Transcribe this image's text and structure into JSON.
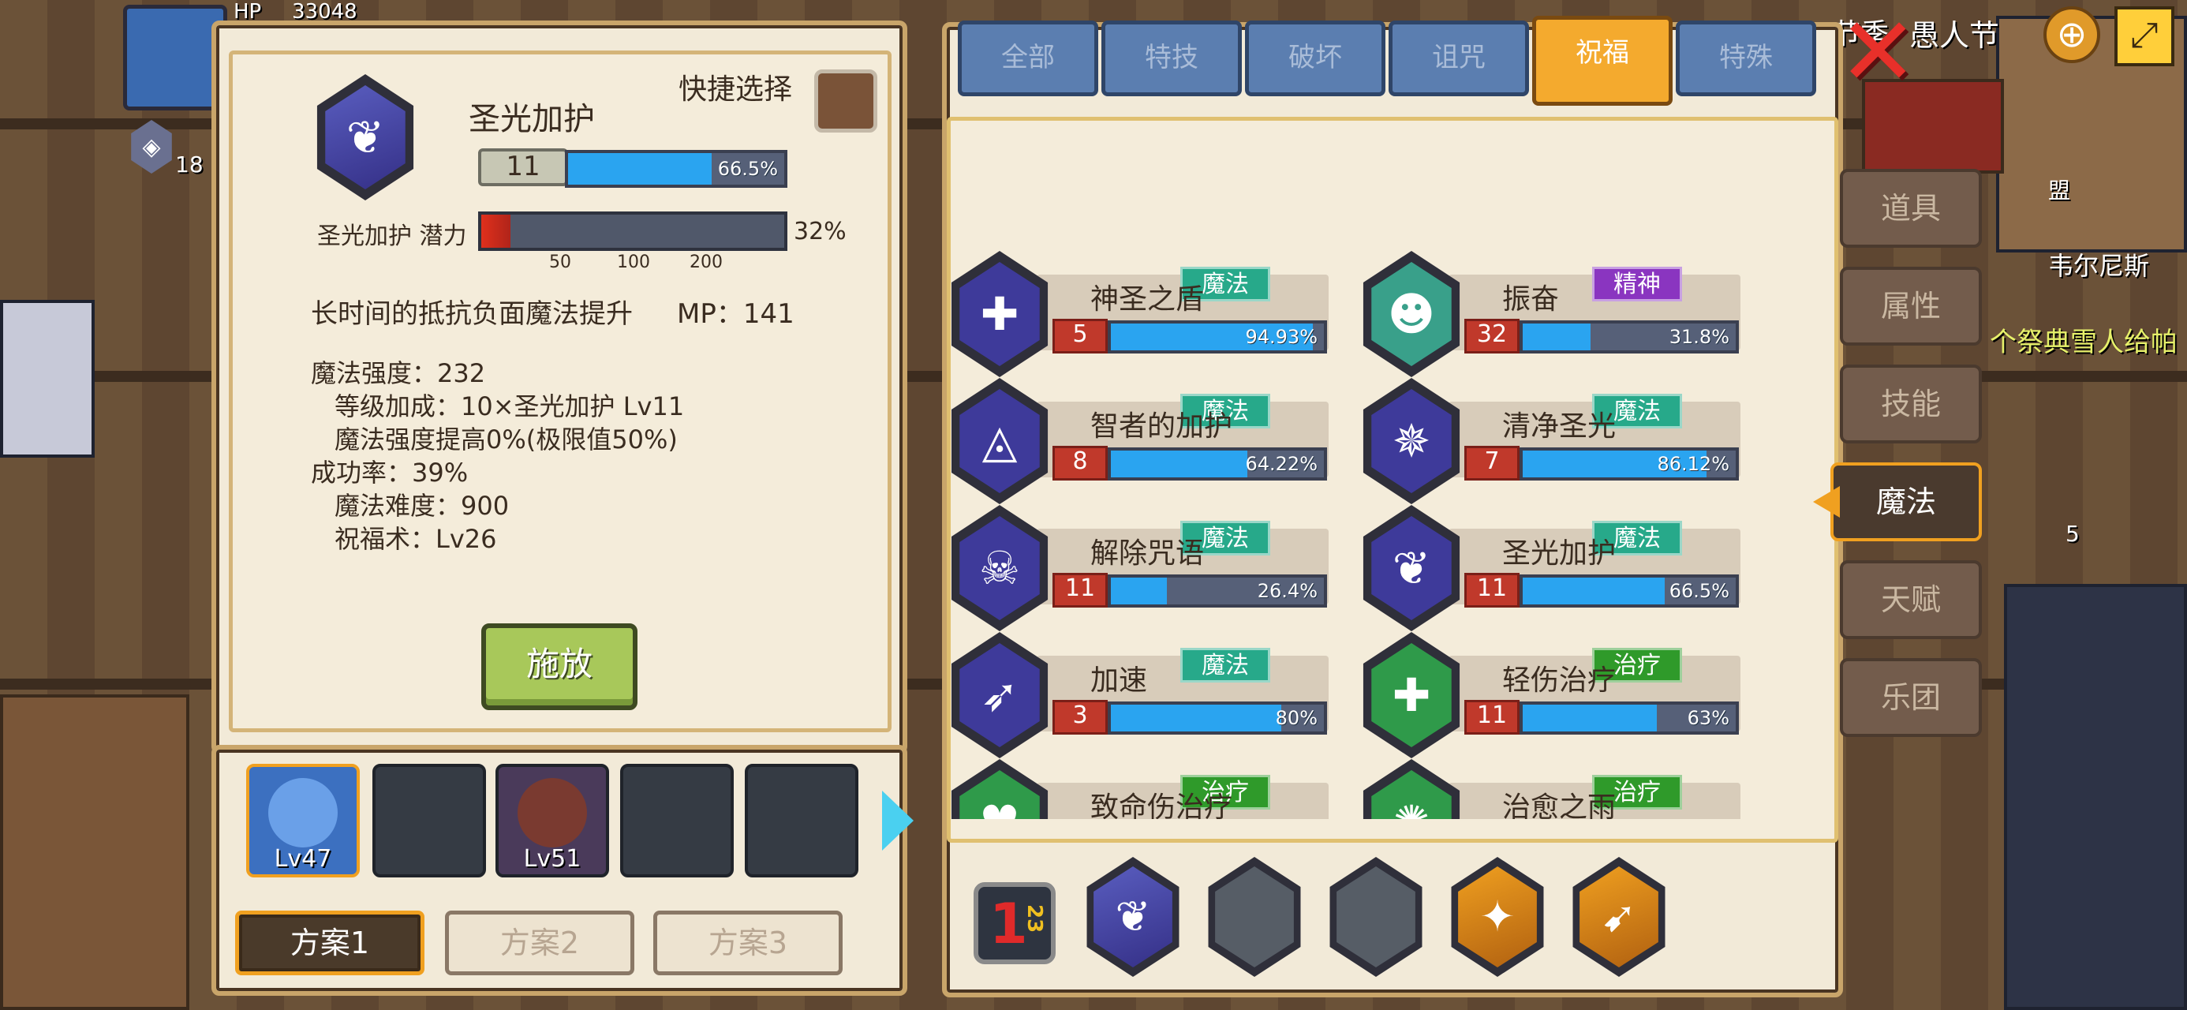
{
  "background": {
    "hud_hp": "HP",
    "hud_hp_value": "33048",
    "hud_level_badge": "18",
    "top_right_text": "愚人节",
    "top_right_prefix": "节季",
    "npc_name": "韦尔尼斯",
    "npc_quest": "个祭典雪人给帕",
    "item_count": "5",
    "label_misc": "盟"
  },
  "detail": {
    "quick_select_label": "快捷选择",
    "skill_name": "圣光加护",
    "skill_level": "11",
    "skill_progress": 0.665,
    "skill_progress_text": "66.5%",
    "potential_label": "圣光加护 潜力",
    "potential_value": 0.32,
    "potential_text": "32%",
    "potential_ticks": [
      "50",
      "100",
      "200"
    ],
    "desc_line": "长时间的抵抗负面魔法提升",
    "mp_text": "MP：141",
    "stats": [
      {
        "text": "魔法强度：232",
        "indent": false
      },
      {
        "text": "等级加成：10×圣光加护 Lv11",
        "indent": true
      },
      {
        "text": "魔法强度提高0%(极限值50%)",
        "indent": true
      },
      {
        "text": "成功率：39%",
        "indent": false
      },
      {
        "text": "魔法难度：900",
        "indent": true
      },
      {
        "text": "祝福术：Lv26",
        "indent": true
      }
    ],
    "cast_button": "施放"
  },
  "party": {
    "members": [
      {
        "level": "Lv47",
        "filled": true,
        "selected": true
      },
      {
        "level": "",
        "filled": false
      },
      {
        "level": "Lv51",
        "filled": true,
        "selected": false
      },
      {
        "level": "",
        "filled": false
      },
      {
        "level": "",
        "filled": false
      }
    ],
    "plans": [
      "方案1",
      "方案2",
      "方案3"
    ],
    "active_plan": 0
  },
  "tabs": [
    {
      "label": "全部",
      "active": false
    },
    {
      "label": "特技",
      "active": false
    },
    {
      "label": "破坏",
      "active": false
    },
    {
      "label": "诅咒",
      "active": false
    },
    {
      "label": "祝福",
      "active": true
    },
    {
      "label": "特殊",
      "active": false
    }
  ],
  "side_menu": [
    {
      "label": "道具",
      "active": false
    },
    {
      "label": "属性",
      "active": false
    },
    {
      "label": "技能",
      "active": false
    },
    {
      "label": "魔法",
      "active": true
    },
    {
      "label": "天赋",
      "active": false
    },
    {
      "label": "乐团",
      "active": false
    }
  ],
  "skills": [
    {
      "name": "神圣之盾",
      "level": "5",
      "progress": 0.9493,
      "pct": "94.93%",
      "type": "魔法",
      "type_color": "#27a98a",
      "icon": "shield-cross-icon",
      "icon_bg": "#3e3a9a",
      "glyph": "✚"
    },
    {
      "name": "振奋",
      "level": "32",
      "progress": 0.318,
      "pct": "31.8%",
      "type": "精神",
      "type_color": "#8a35c0",
      "icon": "spirit-face-icon",
      "icon_bg": "#39a08a",
      "glyph": "☻"
    },
    {
      "name": "智者的加护",
      "level": "8",
      "progress": 0.6422,
      "pct": "64.22%",
      "type": "魔法",
      "type_color": "#27a98a",
      "icon": "eye-pyramid-icon",
      "icon_bg": "#3e3a9a",
      "glyph": "◬"
    },
    {
      "name": "清净圣光",
      "level": "7",
      "progress": 0.8612,
      "pct": "86.12%",
      "type": "魔法",
      "type_color": "#27a98a",
      "icon": "winged-light-icon",
      "icon_bg": "#3e3a9a",
      "glyph": "✵"
    },
    {
      "name": "解除咒语",
      "level": "11",
      "progress": 0.264,
      "pct": "26.4%",
      "type": "魔法",
      "type_color": "#27a98a",
      "icon": "skull-icon",
      "icon_bg": "#3e3a9a",
      "glyph": "☠"
    },
    {
      "name": "圣光加护",
      "level": "11",
      "progress": 0.665,
      "pct": "66.5%",
      "type": "魔法",
      "type_color": "#27a98a",
      "icon": "holy-wings-icon",
      "icon_bg": "#3e3a9a",
      "glyph": "❦"
    },
    {
      "name": "加速",
      "level": "3",
      "progress": 0.8,
      "pct": "80%",
      "type": "魔法",
      "type_color": "#27a98a",
      "icon": "winged-boot-icon",
      "icon_bg": "#3e3a9a",
      "glyph": "➶"
    },
    {
      "name": "轻伤治疗",
      "level": "11",
      "progress": 0.63,
      "pct": "63%",
      "type": "治疗",
      "type_color": "#2f9a2a",
      "icon": "heal-plus-icon",
      "icon_bg": "#2f9a4a",
      "glyph": "✚"
    },
    {
      "name": "致命伤治疗",
      "level": "",
      "progress": 0,
      "pct": "",
      "type": "治疗",
      "type_color": "#2f9a2a",
      "icon": "heart-heal-icon",
      "icon_bg": "#2f9a4a",
      "glyph": "♥"
    },
    {
      "name": "治愈之雨",
      "level": "",
      "progress": 0,
      "pct": "",
      "type": "治疗",
      "type_color": "#2f9a2a",
      "icon": "rain-heal-icon",
      "icon_bg": "#2f9a4a",
      "glyph": "✺"
    }
  ],
  "quickbar": {
    "set_indicator": "1",
    "set_sub": "23",
    "slots": [
      {
        "icon": "holy-wings-icon",
        "kind": "purple",
        "glyph": "❦"
      },
      {
        "icon": "",
        "kind": "empty",
        "glyph": ""
      },
      {
        "icon": "",
        "kind": "empty",
        "glyph": ""
      },
      {
        "icon": "shuriken-icon",
        "kind": "orange",
        "glyph": "✦"
      },
      {
        "icon": "spear-icon",
        "kind": "orange",
        "glyph": "➹"
      }
    ]
  }
}
